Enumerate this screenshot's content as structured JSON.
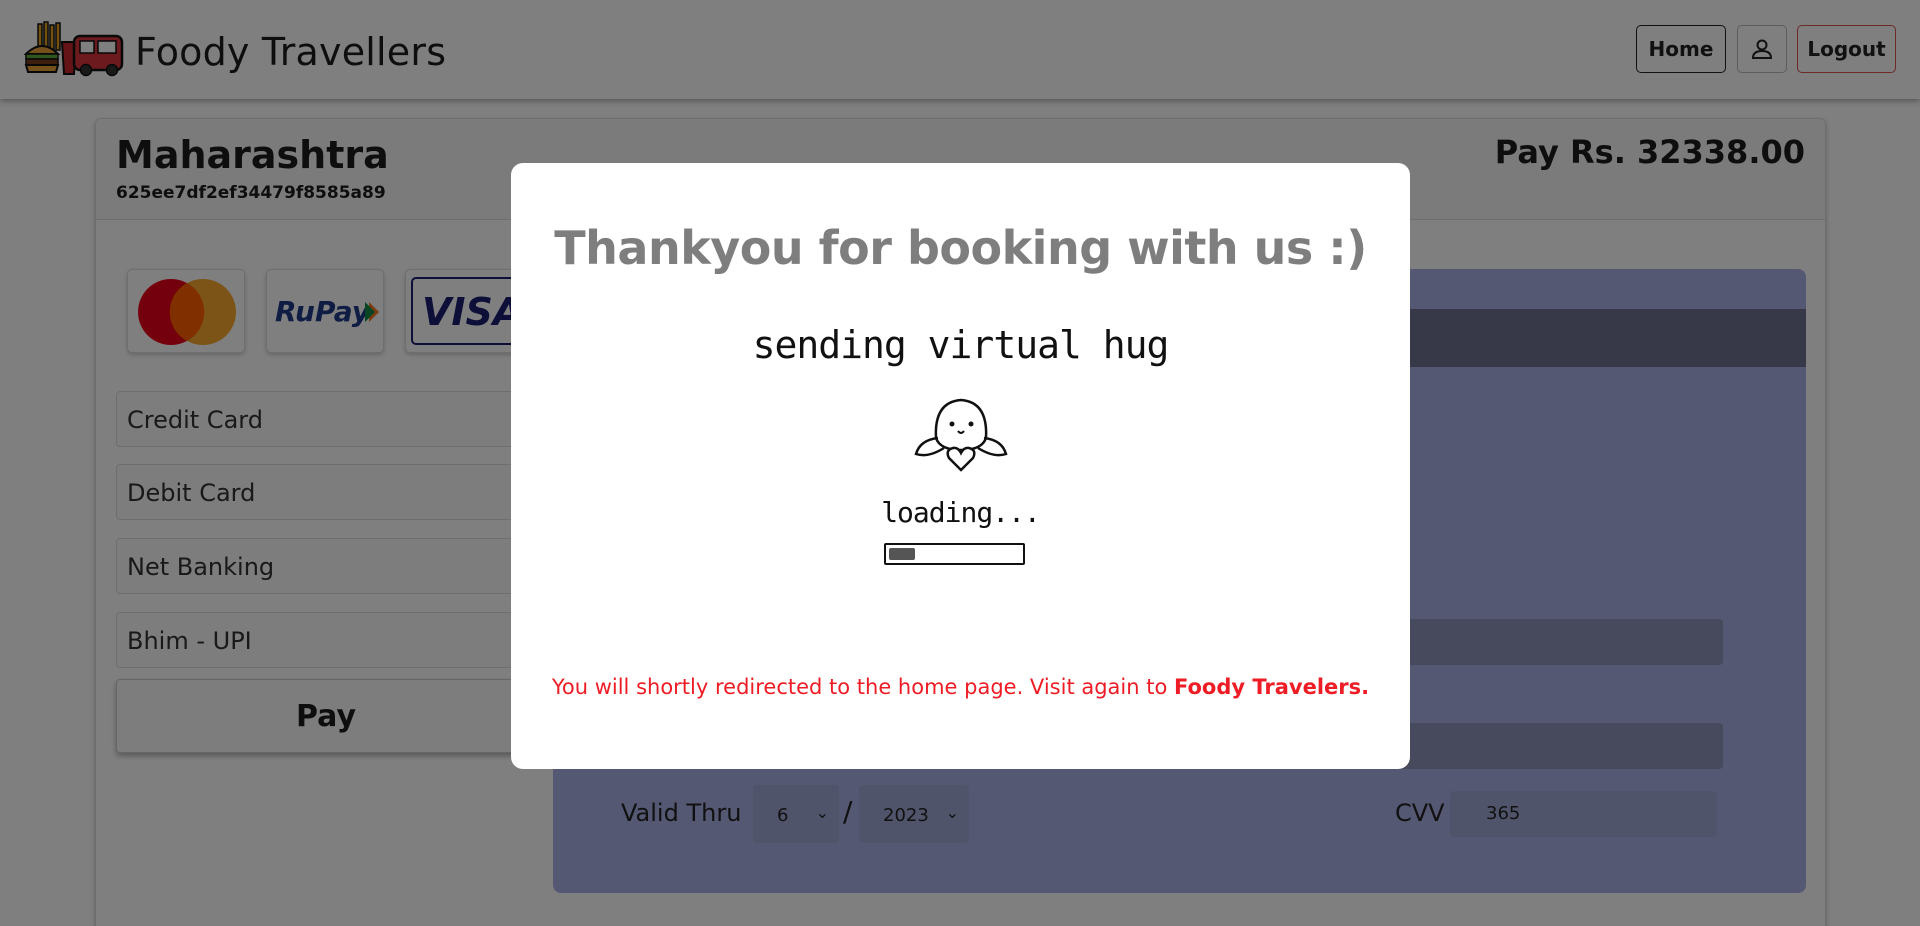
{
  "navbar": {
    "brand": "Foody Travellers",
    "home_label": "Home",
    "logout_label": "Logout"
  },
  "booking": {
    "state": "Maharashtra",
    "id": "625ee7df2ef34479f8585a89",
    "pay_label": "Pay Rs. 32338.00"
  },
  "payment_logos": [
    "mastercard-logo",
    "RuPay",
    "VISA"
  ],
  "methods": [
    "Credit Card",
    "Debit Card",
    "Net Banking",
    "Bhim - UPI"
  ],
  "pay_button": "Pay",
  "card_form": {
    "valid_thru_label": "Valid Thru",
    "month": "6",
    "year": "2023",
    "slash": "/",
    "cvv_label": "CVV",
    "cvv_value": "365"
  },
  "modal": {
    "title": "Thankyou for booking with us :)",
    "hug_text": "sending virtual hug",
    "loading_text": "loading...",
    "loading_progress": 0.2,
    "redirect_text": "You will shortly redirected to the home page. Visit again to ",
    "redirect_brand": "Foody Travelers."
  },
  "colors": {
    "redirect_text": "#ee1c25",
    "panel": "#a8b0e6",
    "title": "#7e7e7e"
  }
}
